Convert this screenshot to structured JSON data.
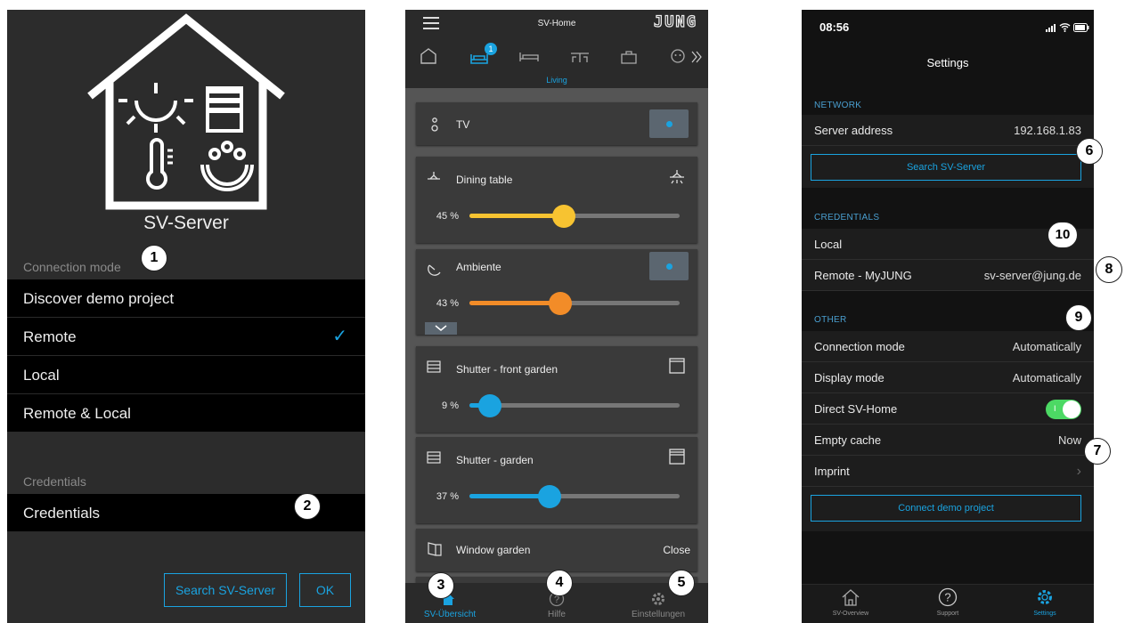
{
  "panel1": {
    "server_title": "SV-Server",
    "connection_mode_label": "Connection mode",
    "modes": [
      "Discover demo project",
      "Remote",
      "Local",
      "Remote & Local"
    ],
    "selected_mode": "Remote",
    "checkmark": "✓",
    "credentials_section": "Credentials",
    "credentials_row": "Credentials",
    "search_button": "Search SV-Server",
    "ok_button": "OK"
  },
  "panel2": {
    "title": "SV-Home",
    "brand": "JUNG",
    "badge": "1",
    "room": "Living",
    "cards": {
      "tv": "TV",
      "dining": "Dining table",
      "dining_pct": "45 %",
      "dining_value": 45,
      "ambiente": "Ambiente",
      "ambiente_pct": "43 %",
      "ambiente_value": 43,
      "shutter_front": "Shutter - front garden",
      "shutter_front_pct": "9 %",
      "shutter_front_value": 9,
      "shutter_garden": "Shutter - garden",
      "shutter_garden_pct": "37 %",
      "shutter_garden_value": 37,
      "window": "Window garden",
      "window_state": "Close"
    },
    "footer": [
      "SV-Übersicht",
      "Hilfe",
      "Einstellungen"
    ]
  },
  "panel3": {
    "time": "08:56",
    "title": "Settings",
    "network_label": "NETWORK",
    "server_address_label": "Server address",
    "server_address_value": "192.168.1.83",
    "search_button": "Search SV-Server",
    "credentials_label": "CREDENTIALS",
    "local_label": "Local",
    "remote_label": "Remote - MyJUNG",
    "remote_value": "sv-server@jung.de",
    "other_label": "OTHER",
    "connection_mode_label": "Connection mode",
    "connection_mode_value": "Automatically",
    "display_mode_label": "Display mode",
    "display_mode_value": "Automatically",
    "direct_label": "Direct SV-Home",
    "toggle_on_text": "I",
    "empty_cache_label": "Empty cache",
    "empty_cache_value": "Now",
    "imprint_label": "Imprint",
    "imprint_chevron": "›",
    "connect_demo_button": "Connect demo project",
    "footer": [
      "SV-Overview",
      "Support",
      "Settings"
    ]
  },
  "callouts": [
    "1",
    "2",
    "3",
    "4",
    "5",
    "6",
    "7",
    "8",
    "9",
    "10"
  ],
  "colors": {
    "accent": "#1aa3e0",
    "yellow": "#f7c331",
    "orange": "#f28c28",
    "toggle_green": "#4cd964"
  }
}
